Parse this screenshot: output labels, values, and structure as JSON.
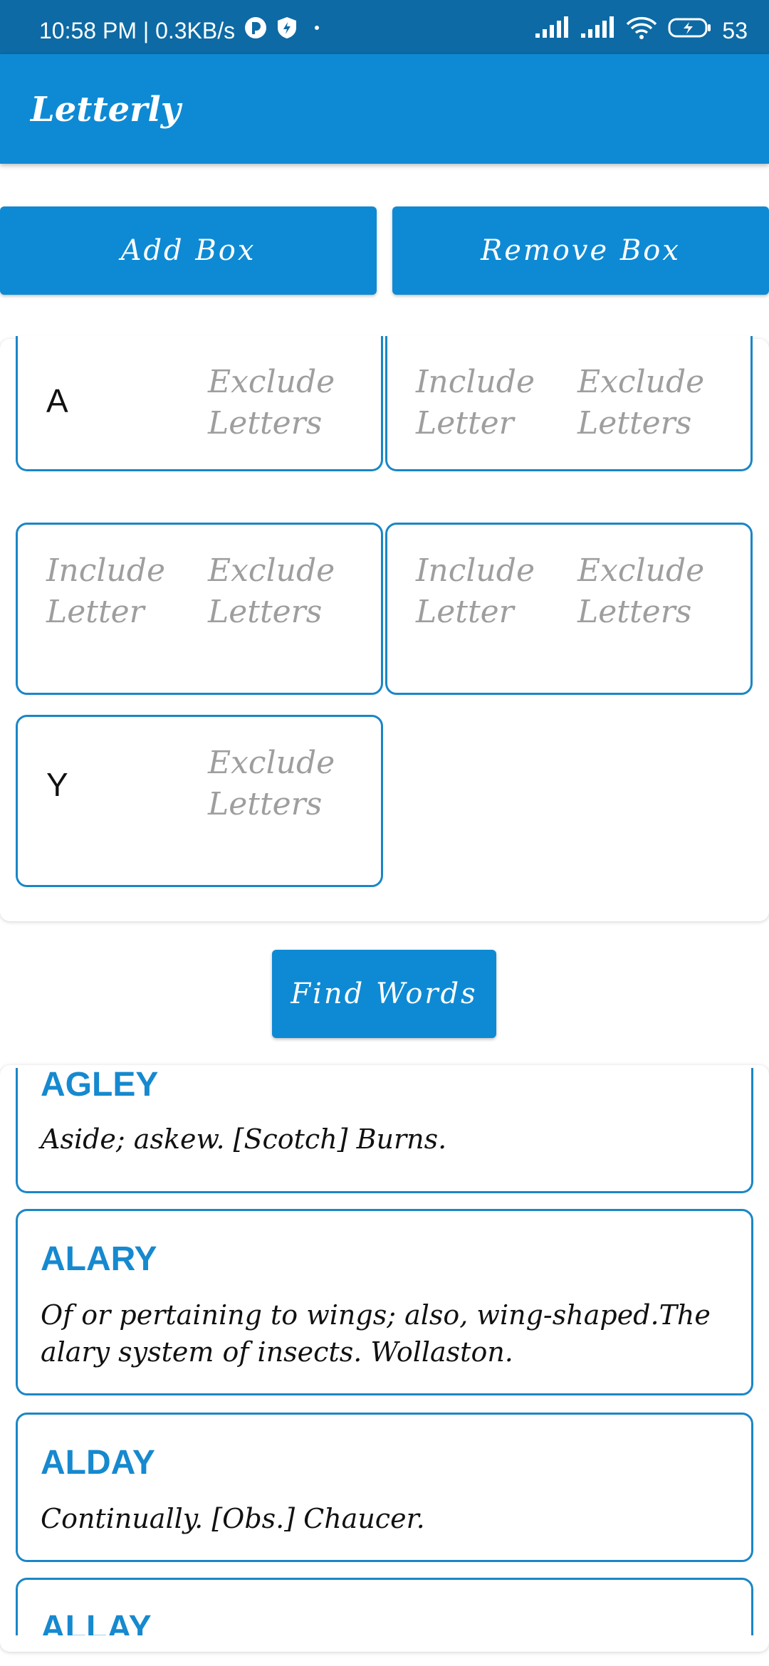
{
  "status": {
    "time": "10:58 PM | 0.3KB/s",
    "battery": "53"
  },
  "app": {
    "title": "Letterly"
  },
  "actions": {
    "add_label": "Add Box",
    "remove_label": "Remove Box",
    "find_label": "Find Words"
  },
  "boxes": [
    {
      "include": "A",
      "include_placeholder": "Include Letter",
      "exclude_placeholder": "Exclude Letters"
    },
    {
      "include": "",
      "include_placeholder": "Include Letter",
      "exclude_placeholder": "Exclude Letters"
    },
    {
      "include": "",
      "include_placeholder": "Include Letter",
      "exclude_placeholder": "Exclude Letters"
    },
    {
      "include": "",
      "include_placeholder": "Include Letter",
      "exclude_placeholder": "Exclude Letters"
    },
    {
      "include": "Y",
      "include_placeholder": "Include Letter",
      "exclude_placeholder": "Exclude Letters"
    }
  ],
  "results": [
    {
      "word": "AGLEY",
      "definition": "Aside; askew. [Scotch] Burns."
    },
    {
      "word": "ALARY",
      "definition": "Of or pertaining to wings; also, wing-shaped.The alary system of insects. Wollaston."
    },
    {
      "word": "ALDAY",
      "definition": "Continually. [Obs.] Chaucer."
    },
    {
      "word": "ALLAY",
      "definition": ""
    }
  ]
}
